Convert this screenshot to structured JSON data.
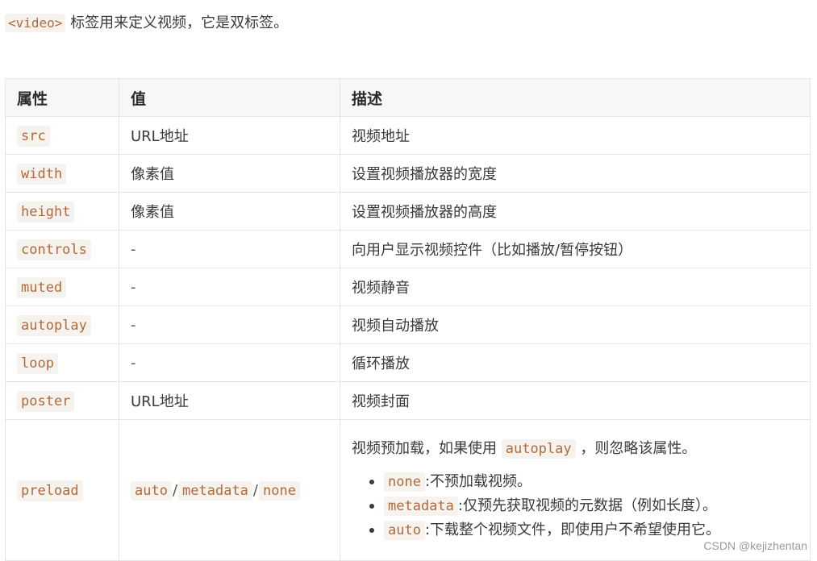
{
  "intro": {
    "tag": "<video>",
    "text": "标签用来定义视频，它是双标签。"
  },
  "table": {
    "headers": [
      "属性",
      "值",
      "描述"
    ],
    "rows": [
      {
        "attr": "src",
        "value": "URL地址",
        "desc": "视频地址"
      },
      {
        "attr": "width",
        "value": "像素值",
        "desc": "设置视频播放器的宽度"
      },
      {
        "attr": "height",
        "value": "像素值",
        "desc": "设置视频播放器的高度"
      },
      {
        "attr": "controls",
        "value": "-",
        "desc": "向用户显示视频控件（比如播放/暂停按钮）"
      },
      {
        "attr": "muted",
        "value": "-",
        "desc": "视频静音"
      },
      {
        "attr": "autoplay",
        "value": "-",
        "desc": "视频自动播放"
      },
      {
        "attr": "loop",
        "value": "-",
        "desc": "循环播放"
      },
      {
        "attr": "poster",
        "value": "URL地址",
        "desc": "视频封面"
      }
    ],
    "preload": {
      "attr": "preload",
      "values": [
        "auto",
        "metadata",
        "none"
      ],
      "separator": "/",
      "desc_before": "视频预加载，如果使用",
      "desc_code": "autoplay",
      "desc_after": "，则忽略该属性。",
      "options": [
        {
          "code": "none",
          "text": ":不预加载视频。"
        },
        {
          "code": "metadata",
          "text": ":仅预先获取视频的元数据（例如长度）。"
        },
        {
          "code": "auto",
          "text": ":下载整个视频文件，即使用户不希望使用它。"
        }
      ]
    }
  },
  "watermark": "CSDN @kejizhentan"
}
